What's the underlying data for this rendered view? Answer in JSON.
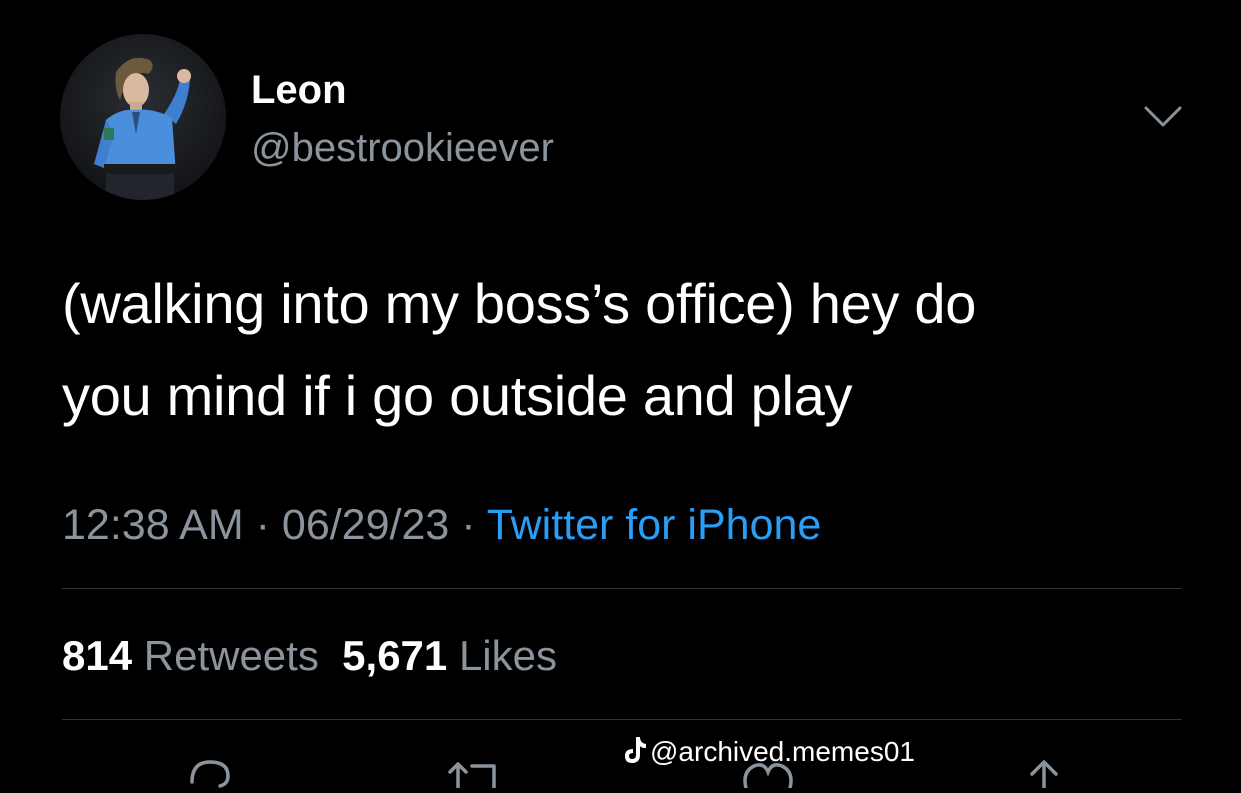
{
  "author": {
    "display_name": "Leon",
    "handle": "@bestrookieever",
    "avatar_icon": "avatar-photo"
  },
  "tweet": {
    "text_line1": "(walking into my boss’s office) hey do",
    "text_line2": "you mind if i go outside and play"
  },
  "meta": {
    "time": "12:38 AM",
    "separator": " · ",
    "date": "06/29/23",
    "source": "Twitter for iPhone"
  },
  "stats": {
    "retweets_count": "814",
    "retweets_label": "Retweets",
    "likes_count": "5,671",
    "likes_label": "Likes"
  },
  "actions": [
    "reply-icon",
    "retweet-icon",
    "like-icon",
    "share-icon"
  ],
  "watermark": {
    "icon": "tiktok-icon",
    "text": "@archived.memes01"
  },
  "colors": {
    "background": "#000000",
    "text": "#ffffff",
    "secondary": "#8b949c",
    "link": "#2a9df4",
    "divider": "#2f3336"
  }
}
